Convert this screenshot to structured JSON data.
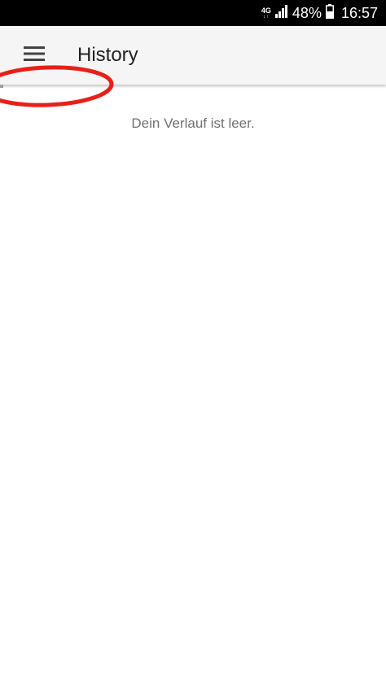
{
  "status_bar": {
    "network_type": "4G",
    "battery_percent": "48%",
    "time": "16:57",
    "icons": [
      "signal-icon",
      "battery-icon"
    ]
  },
  "app_bar": {
    "title": "History",
    "menu_icon": "hamburger-menu-icon",
    "background_color": "#f5f5f5"
  },
  "main": {
    "empty_message": "Dein Verlauf ist leer."
  },
  "annotation": {
    "shape": "ellipse",
    "color": "#e62117"
  }
}
